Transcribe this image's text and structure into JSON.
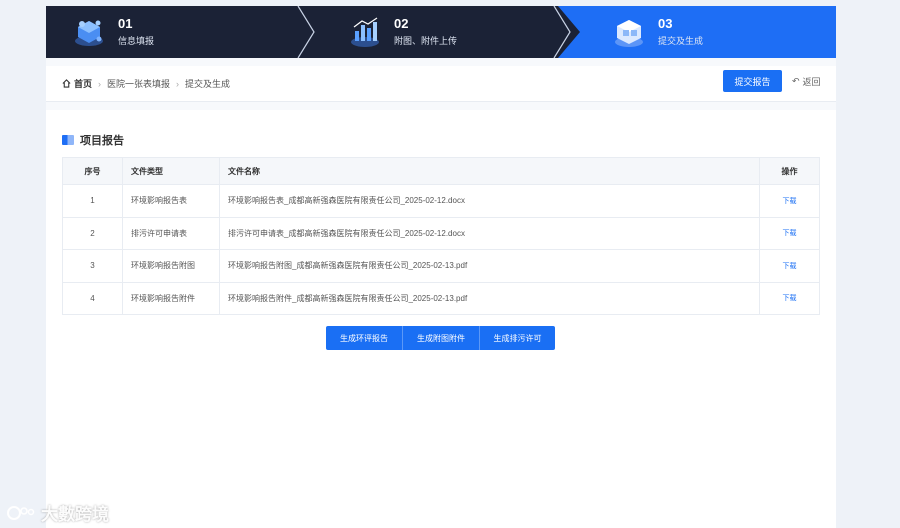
{
  "steps": [
    {
      "num": "01",
      "label": "信息填报",
      "icon": "cube-network-icon"
    },
    {
      "num": "02",
      "label": "附图、附件上传",
      "icon": "chart-upload-icon"
    },
    {
      "num": "03",
      "label": "提交及生成",
      "icon": "document-cube-icon"
    }
  ],
  "breadcrumb": {
    "home": "首页",
    "items": [
      "医院一张表填报",
      "提交及生成"
    ]
  },
  "actions": {
    "submit_label": "提交报告",
    "back_label": "返回"
  },
  "section": {
    "title": "项目报告"
  },
  "table": {
    "headers": {
      "index": "序号",
      "type": "文件类型",
      "name": "文件名称",
      "action": "操作"
    },
    "rows": [
      {
        "index": "1",
        "type": "环境影响报告表",
        "name": "环境影响报告表_成都高新强森医院有限责任公司_2025-02-12.docx",
        "action": "下载"
      },
      {
        "index": "2",
        "type": "排污许可申请表",
        "name": "排污许可申请表_成都高新强森医院有限责任公司_2025-02-12.docx",
        "action": "下载"
      },
      {
        "index": "3",
        "type": "环境影响报告附图",
        "name": "环境影响报告附图_成都高新强森医院有限责任公司_2025-02-13.pdf",
        "action": "下载"
      },
      {
        "index": "4",
        "type": "环境影响报告附件",
        "name": "环境影响报告附件_成都高新强森医院有限责任公司_2025-02-13.pdf",
        "action": "下载"
      }
    ]
  },
  "generate": {
    "report": "生成环评报告",
    "attachments": "生成附图附件",
    "permit": "生成排污许可"
  },
  "watermark": "大數跨境",
  "colors": {
    "primary": "#1a6ff4",
    "stepper_dark": "#1b2236"
  }
}
